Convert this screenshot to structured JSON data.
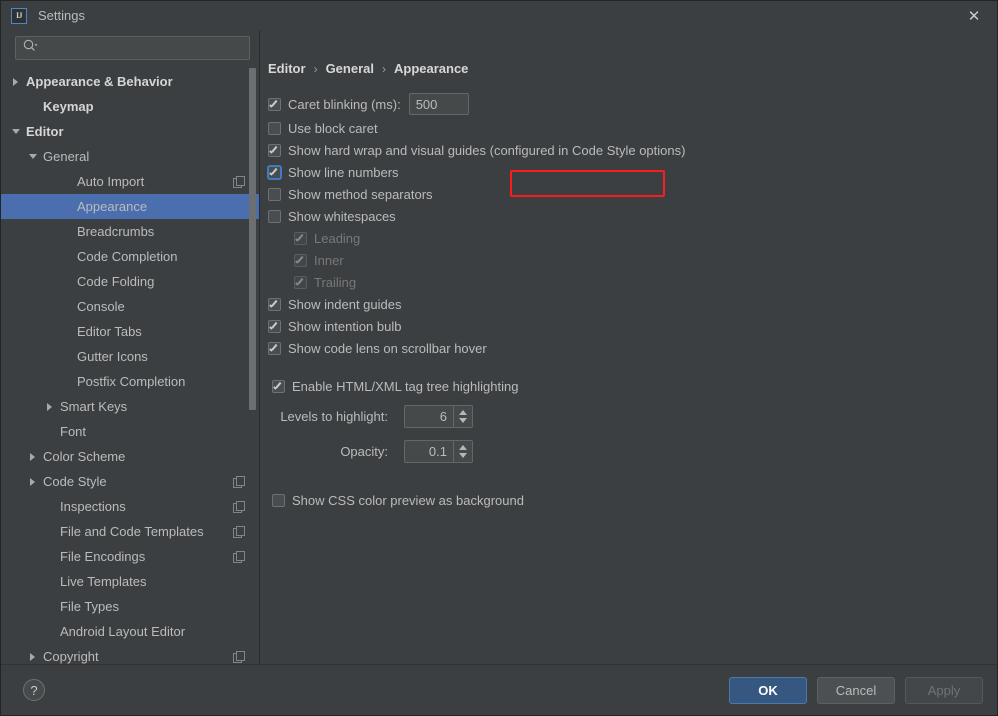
{
  "window": {
    "title": "Settings",
    "logo_text": "IJ",
    "close_icon": "✕"
  },
  "search": {
    "value": "",
    "placeholder": "",
    "icon": "search-icon"
  },
  "sidebar": {
    "items": [
      {
        "label": "Appearance & Behavior",
        "indent": 0,
        "twisty": "right",
        "bold": true,
        "selected": false,
        "copy": false
      },
      {
        "label": "Keymap",
        "indent": 1,
        "twisty": "none",
        "bold": true,
        "selected": false,
        "copy": false
      },
      {
        "label": "Editor",
        "indent": 0,
        "twisty": "down",
        "bold": true,
        "selected": false,
        "copy": false
      },
      {
        "label": "General",
        "indent": 1,
        "twisty": "down",
        "bold": false,
        "selected": false,
        "copy": false
      },
      {
        "label": "Auto Import",
        "indent": 3,
        "twisty": "none",
        "bold": false,
        "selected": false,
        "copy": true
      },
      {
        "label": "Appearance",
        "indent": 3,
        "twisty": "none",
        "bold": false,
        "selected": true,
        "copy": false
      },
      {
        "label": "Breadcrumbs",
        "indent": 3,
        "twisty": "none",
        "bold": false,
        "selected": false,
        "copy": false
      },
      {
        "label": "Code Completion",
        "indent": 3,
        "twisty": "none",
        "bold": false,
        "selected": false,
        "copy": false
      },
      {
        "label": "Code Folding",
        "indent": 3,
        "twisty": "none",
        "bold": false,
        "selected": false,
        "copy": false
      },
      {
        "label": "Console",
        "indent": 3,
        "twisty": "none",
        "bold": false,
        "selected": false,
        "copy": false
      },
      {
        "label": "Editor Tabs",
        "indent": 3,
        "twisty": "none",
        "bold": false,
        "selected": false,
        "copy": false
      },
      {
        "label": "Gutter Icons",
        "indent": 3,
        "twisty": "none",
        "bold": false,
        "selected": false,
        "copy": false
      },
      {
        "label": "Postfix Completion",
        "indent": 3,
        "twisty": "none",
        "bold": false,
        "selected": false,
        "copy": false
      },
      {
        "label": "Smart Keys",
        "indent": 2,
        "twisty": "right",
        "bold": false,
        "selected": false,
        "copy": false
      },
      {
        "label": "Font",
        "indent": 2,
        "twisty": "none",
        "bold": false,
        "selected": false,
        "copy": false
      },
      {
        "label": "Color Scheme",
        "indent": 1,
        "twisty": "right",
        "bold": false,
        "selected": false,
        "copy": false
      },
      {
        "label": "Code Style",
        "indent": 1,
        "twisty": "right",
        "bold": false,
        "selected": false,
        "copy": true
      },
      {
        "label": "Inspections",
        "indent": 2,
        "twisty": "none",
        "bold": false,
        "selected": false,
        "copy": true
      },
      {
        "label": "File and Code Templates",
        "indent": 2,
        "twisty": "none",
        "bold": false,
        "selected": false,
        "copy": true
      },
      {
        "label": "File Encodings",
        "indent": 2,
        "twisty": "none",
        "bold": false,
        "selected": false,
        "copy": true
      },
      {
        "label": "Live Templates",
        "indent": 2,
        "twisty": "none",
        "bold": false,
        "selected": false,
        "copy": false
      },
      {
        "label": "File Types",
        "indent": 2,
        "twisty": "none",
        "bold": false,
        "selected": false,
        "copy": false
      },
      {
        "label": "Android Layout Editor",
        "indent": 2,
        "twisty": "none",
        "bold": false,
        "selected": false,
        "copy": false
      },
      {
        "label": "Copyright",
        "indent": 1,
        "twisty": "right",
        "bold": false,
        "selected": false,
        "copy": true
      }
    ],
    "selection_color": "#4b6eaf"
  },
  "main": {
    "breadcrumb": {
      "parts": [
        "Editor",
        "General",
        "Appearance"
      ],
      "separator": "›"
    },
    "caret_blinking": {
      "label": "Caret blinking (ms):",
      "checked": true,
      "value": "500"
    },
    "options": [
      {
        "label": "Use block caret",
        "checked": false,
        "disabled": false,
        "indent": 0,
        "focused": false
      },
      {
        "label": "Show hard wrap and visual guides (configured in Code Style options)",
        "checked": true,
        "disabled": false,
        "indent": 0,
        "focused": false
      },
      {
        "label": "Show line numbers",
        "checked": true,
        "disabled": false,
        "indent": 0,
        "focused": true
      },
      {
        "label": "Show method separators",
        "checked": false,
        "disabled": false,
        "indent": 0,
        "focused": false
      },
      {
        "label": "Show whitespaces",
        "checked": false,
        "disabled": false,
        "indent": 0,
        "focused": false
      },
      {
        "label": "Leading",
        "checked": true,
        "disabled": true,
        "indent": 1,
        "focused": false
      },
      {
        "label": "Inner",
        "checked": true,
        "disabled": true,
        "indent": 1,
        "focused": false
      },
      {
        "label": "Trailing",
        "checked": true,
        "disabled": true,
        "indent": 1,
        "focused": false
      },
      {
        "label": "Show indent guides",
        "checked": true,
        "disabled": false,
        "indent": 0,
        "focused": false
      },
      {
        "label": "Show intention bulb",
        "checked": true,
        "disabled": false,
        "indent": 0,
        "focused": false
      },
      {
        "label": "Show code lens on scrollbar hover",
        "checked": true,
        "disabled": false,
        "indent": 0,
        "focused": false
      }
    ],
    "html_group": {
      "enable": {
        "label": "Enable HTML/XML tag tree highlighting",
        "checked": true
      },
      "levels": {
        "label": "Levels to highlight:",
        "value": "6"
      },
      "opacity": {
        "label": "Opacity:",
        "value": "0.1"
      }
    },
    "css_preview": {
      "label": "Show CSS color preview as background",
      "checked": false
    },
    "highlight_box_color": "#fd1c1c"
  },
  "footer": {
    "help_label": "?",
    "buttons": [
      {
        "label": "OK",
        "style": "primary",
        "disabled": false
      },
      {
        "label": "Cancel",
        "style": "normal",
        "disabled": false
      },
      {
        "label": "Apply",
        "style": "normal",
        "disabled": true
      }
    ]
  }
}
